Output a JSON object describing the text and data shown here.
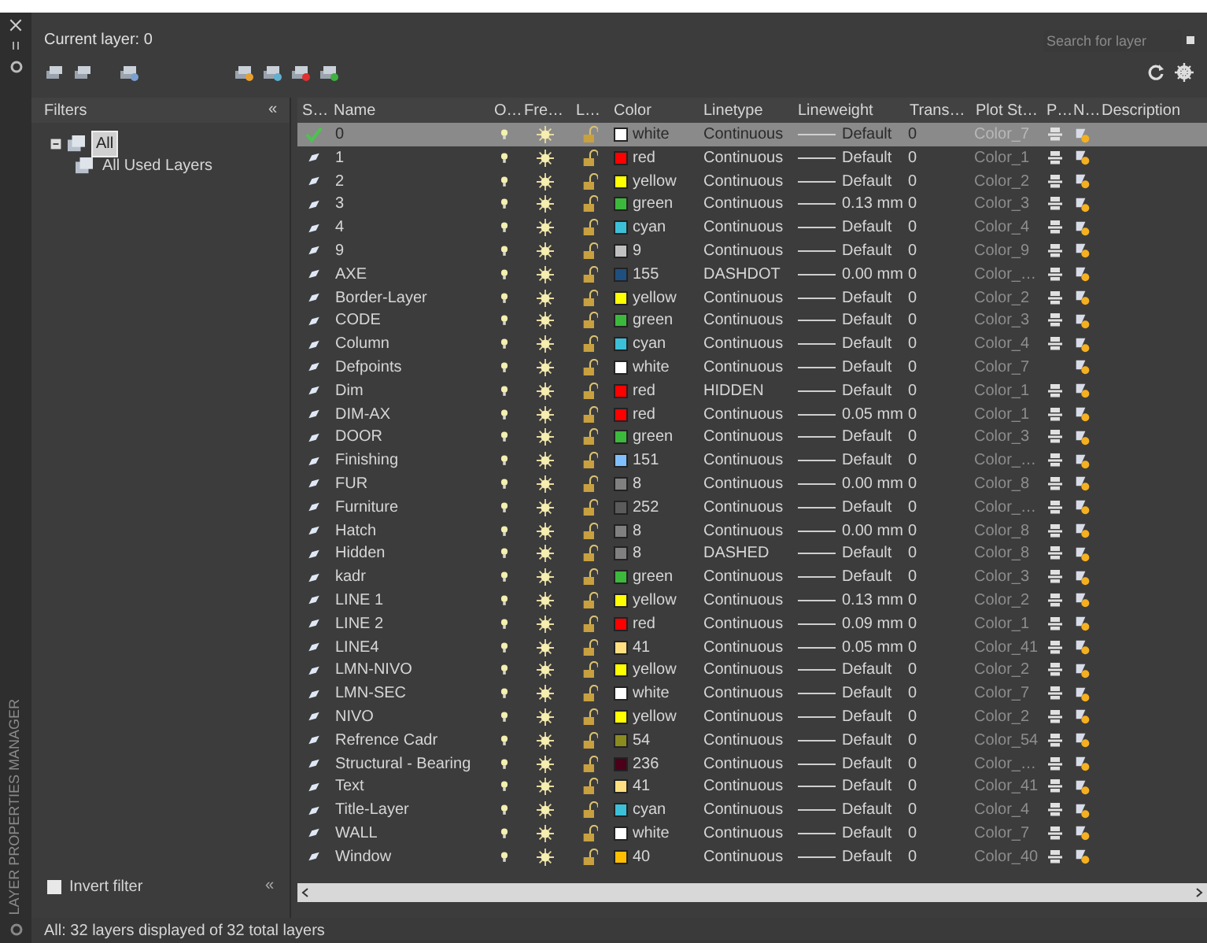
{
  "current_layer": "Current layer: 0",
  "search": {
    "placeholder": "Search for layer"
  },
  "filters": {
    "title": "Filters",
    "collapse": "«",
    "tree": [
      {
        "label": "All",
        "selected": true,
        "expanded": true,
        "children": [
          {
            "label": "All Used Layers",
            "selected": false
          }
        ]
      }
    ],
    "invert_filter": {
      "label": "Invert filter",
      "checked": false
    },
    "collapse_bottom": "«"
  },
  "columns": [
    "S…",
    "Name",
    "O…",
    "Fre…",
    "L…",
    "Color",
    "Linetype",
    "Lineweight",
    "Trans…",
    "Plot St…",
    "P…",
    "N…",
    "Description"
  ],
  "rows": [
    {
      "current": true,
      "selected": true,
      "name": "0",
      "on": true,
      "frozen": false,
      "locked": false,
      "color_name": "white",
      "color": "#ffffff",
      "linetype": "Continuous",
      "lineweight": "Default",
      "transparency": "0",
      "plot_style": "Color_7",
      "plot": true
    },
    {
      "current": false,
      "selected": false,
      "name": "1",
      "on": true,
      "frozen": false,
      "locked": false,
      "color_name": "red",
      "color": "#ff0000",
      "linetype": "Continuous",
      "lineweight": "Default",
      "transparency": "0",
      "plot_style": "Color_1",
      "plot": true
    },
    {
      "current": false,
      "selected": false,
      "name": "2",
      "on": true,
      "frozen": false,
      "locked": false,
      "color_name": "yellow",
      "color": "#ffff00",
      "linetype": "Continuous",
      "lineweight": "Default",
      "transparency": "0",
      "plot_style": "Color_2",
      "plot": true
    },
    {
      "current": false,
      "selected": false,
      "name": "3",
      "on": true,
      "frozen": false,
      "locked": false,
      "color_name": "green",
      "color": "#3cb83c",
      "linetype": "Continuous",
      "lineweight": "0.13 mm",
      "transparency": "0",
      "plot_style": "Color_3",
      "plot": true
    },
    {
      "current": false,
      "selected": false,
      "name": "4",
      "on": true,
      "frozen": false,
      "locked": false,
      "color_name": "cyan",
      "color": "#3cc0d8",
      "linetype": "Continuous",
      "lineweight": "Default",
      "transparency": "0",
      "plot_style": "Color_4",
      "plot": true
    },
    {
      "current": false,
      "selected": false,
      "name": "9",
      "on": true,
      "frozen": false,
      "locked": false,
      "color_name": "9",
      "color": "#c0c0c0",
      "linetype": "Continuous",
      "lineweight": "Default",
      "transparency": "0",
      "plot_style": "Color_9",
      "plot": true
    },
    {
      "current": false,
      "selected": false,
      "name": "AXE",
      "on": true,
      "frozen": false,
      "locked": false,
      "color_name": "155",
      "color": "#1f4f7f",
      "linetype": "DASHDOT",
      "lineweight": "0.00 mm",
      "transparency": "0",
      "plot_style": "Color_…",
      "plot": true
    },
    {
      "current": false,
      "selected": false,
      "name": "Border-Layer",
      "on": true,
      "frozen": false,
      "locked": false,
      "color_name": "yellow",
      "color": "#ffff00",
      "linetype": "Continuous",
      "lineweight": "Default",
      "transparency": "0",
      "plot_style": "Color_2",
      "plot": true
    },
    {
      "current": false,
      "selected": false,
      "name": "CODE",
      "on": true,
      "frozen": false,
      "locked": false,
      "color_name": "green",
      "color": "#3cb83c",
      "linetype": "Continuous",
      "lineweight": "Default",
      "transparency": "0",
      "plot_style": "Color_3",
      "plot": true
    },
    {
      "current": false,
      "selected": false,
      "name": "Column",
      "on": true,
      "frozen": false,
      "locked": false,
      "color_name": "cyan",
      "color": "#3cc0d8",
      "linetype": "Continuous",
      "lineweight": "Default",
      "transparency": "0",
      "plot_style": "Color_4",
      "plot": true
    },
    {
      "current": false,
      "selected": false,
      "name": "Defpoints",
      "on": true,
      "frozen": false,
      "locked": false,
      "color_name": "white",
      "color": "#ffffff",
      "linetype": "Continuous",
      "lineweight": "Default",
      "transparency": "0",
      "plot_style": "Color_7",
      "plot": false
    },
    {
      "current": false,
      "selected": false,
      "name": "Dim",
      "on": true,
      "frozen": false,
      "locked": false,
      "color_name": "red",
      "color": "#ff0000",
      "linetype": "HIDDEN",
      "lineweight": "Default",
      "transparency": "0",
      "plot_style": "Color_1",
      "plot": true
    },
    {
      "current": false,
      "selected": false,
      "name": "DIM-AX",
      "on": true,
      "frozen": false,
      "locked": false,
      "color_name": "red",
      "color": "#ff0000",
      "linetype": "Continuous",
      "lineweight": "0.05 mm",
      "transparency": "0",
      "plot_style": "Color_1",
      "plot": true
    },
    {
      "current": false,
      "selected": false,
      "name": "DOOR",
      "on": true,
      "frozen": false,
      "locked": false,
      "color_name": "green",
      "color": "#3cb83c",
      "linetype": "Continuous",
      "lineweight": "Default",
      "transparency": "0",
      "plot_style": "Color_3",
      "plot": true
    },
    {
      "current": false,
      "selected": false,
      "name": "Finishing",
      "on": true,
      "frozen": false,
      "locked": false,
      "color_name": "151",
      "color": "#7fbfff",
      "linetype": "Continuous",
      "lineweight": "Default",
      "transparency": "0",
      "plot_style": "Color_…",
      "plot": true
    },
    {
      "current": false,
      "selected": false,
      "name": "FUR",
      "on": true,
      "frozen": false,
      "locked": false,
      "color_name": "8",
      "color": "#808080",
      "linetype": "Continuous",
      "lineweight": "0.00 mm",
      "transparency": "0",
      "plot_style": "Color_8",
      "plot": true
    },
    {
      "current": false,
      "selected": false,
      "name": "Furniture",
      "on": true,
      "frozen": false,
      "locked": false,
      "color_name": "252",
      "color": "#5b5b5b",
      "linetype": "Continuous",
      "lineweight": "Default",
      "transparency": "0",
      "plot_style": "Color_…",
      "plot": true
    },
    {
      "current": false,
      "selected": false,
      "name": "Hatch",
      "on": true,
      "frozen": false,
      "locked": false,
      "color_name": "8",
      "color": "#808080",
      "linetype": "Continuous",
      "lineweight": "0.00 mm",
      "transparency": "0",
      "plot_style": "Color_8",
      "plot": true
    },
    {
      "current": false,
      "selected": false,
      "name": "Hidden",
      "on": true,
      "frozen": false,
      "locked": false,
      "color_name": "8",
      "color": "#808080",
      "linetype": "DASHED",
      "lineweight": "Default",
      "transparency": "0",
      "plot_style": "Color_8",
      "plot": true
    },
    {
      "current": false,
      "selected": false,
      "name": "kadr",
      "on": true,
      "frozen": false,
      "locked": false,
      "color_name": "green",
      "color": "#3cb83c",
      "linetype": "Continuous",
      "lineweight": "Default",
      "transparency": "0",
      "plot_style": "Color_3",
      "plot": true
    },
    {
      "current": false,
      "selected": false,
      "name": "LINE 1",
      "on": true,
      "frozen": false,
      "locked": false,
      "color_name": "yellow",
      "color": "#ffff00",
      "linetype": "Continuous",
      "lineweight": "0.13 mm",
      "transparency": "0",
      "plot_style": "Color_2",
      "plot": true
    },
    {
      "current": false,
      "selected": false,
      "name": "LINE 2",
      "on": true,
      "frozen": false,
      "locked": false,
      "color_name": "red",
      "color": "#ff0000",
      "linetype": "Continuous",
      "lineweight": "0.09 mm",
      "transparency": "0",
      "plot_style": "Color_1",
      "plot": true
    },
    {
      "current": false,
      "selected": false,
      "name": "LINE4",
      "on": true,
      "frozen": false,
      "locked": false,
      "color_name": "41",
      "color": "#ffdf7f",
      "linetype": "Continuous",
      "lineweight": "0.05 mm",
      "transparency": "0",
      "plot_style": "Color_41",
      "plot": true
    },
    {
      "current": false,
      "selected": false,
      "name": "LMN-NIVO",
      "on": true,
      "frozen": false,
      "locked": false,
      "color_name": "yellow",
      "color": "#ffff00",
      "linetype": "Continuous",
      "lineweight": "Default",
      "transparency": "0",
      "plot_style": "Color_2",
      "plot": true
    },
    {
      "current": false,
      "selected": false,
      "name": "LMN-SEC",
      "on": true,
      "frozen": false,
      "locked": false,
      "color_name": "white",
      "color": "#ffffff",
      "linetype": "Continuous",
      "lineweight": "Default",
      "transparency": "0",
      "plot_style": "Color_7",
      "plot": true
    },
    {
      "current": false,
      "selected": false,
      "name": "NIVO",
      "on": true,
      "frozen": false,
      "locked": false,
      "color_name": "yellow",
      "color": "#ffff00",
      "linetype": "Continuous",
      "lineweight": "Default",
      "transparency": "0",
      "plot_style": "Color_2",
      "plot": true
    },
    {
      "current": false,
      "selected": false,
      "name": "Refrence Cadr",
      "on": true,
      "frozen": false,
      "locked": false,
      "color_name": "54",
      "color": "#8b8b20",
      "linetype": "Continuous",
      "lineweight": "Default",
      "transparency": "0",
      "plot_style": "Color_54",
      "plot": true
    },
    {
      "current": false,
      "selected": false,
      "name": "Structural - Bearing",
      "on": true,
      "frozen": false,
      "locked": false,
      "color_name": "236",
      "color": "#4c0019",
      "linetype": "Continuous",
      "lineweight": "Default",
      "transparency": "0",
      "plot_style": "Color_…",
      "plot": true
    },
    {
      "current": false,
      "selected": false,
      "name": "Text",
      "on": true,
      "frozen": false,
      "locked": false,
      "color_name": "41",
      "color": "#ffdf7f",
      "linetype": "Continuous",
      "lineweight": "Default",
      "transparency": "0",
      "plot_style": "Color_41",
      "plot": true
    },
    {
      "current": false,
      "selected": false,
      "name": "Title-Layer",
      "on": true,
      "frozen": false,
      "locked": false,
      "color_name": "cyan",
      "color": "#3cc0d8",
      "linetype": "Continuous",
      "lineweight": "Default",
      "transparency": "0",
      "plot_style": "Color_4",
      "plot": true
    },
    {
      "current": false,
      "selected": false,
      "name": "WALL",
      "on": true,
      "frozen": false,
      "locked": false,
      "color_name": "white",
      "color": "#ffffff",
      "linetype": "Continuous",
      "lineweight": "Default",
      "transparency": "0",
      "plot_style": "Color_7",
      "plot": true
    },
    {
      "current": false,
      "selected": false,
      "name": "Window",
      "on": true,
      "frozen": false,
      "locked": false,
      "color_name": "40",
      "color": "#ffbf00",
      "linetype": "Continuous",
      "lineweight": "Default",
      "transparency": "0",
      "plot_style": "Color_40",
      "plot": true
    }
  ],
  "status_bar": "All: 32 layers displayed of 32 total layers",
  "palette_title": "LAYER PROPERTIES MANAGER"
}
